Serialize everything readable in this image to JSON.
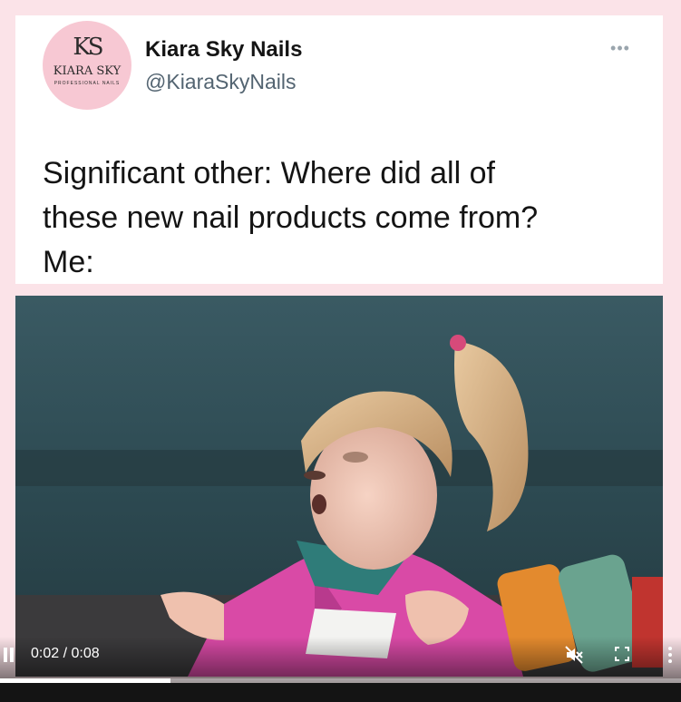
{
  "tweet": {
    "avatar": {
      "monogram": "KS",
      "brand": "KIARA SKY",
      "sub": "PROFESSIONAL NAILS"
    },
    "display_name": "Kiara Sky Nails",
    "handle": "@KiaraSkyNails",
    "more_label": "•••",
    "text": "Significant other: Where did all of\nthese new nail products come from?\nMe:"
  },
  "video": {
    "time_label": "0:02 / 0:08",
    "progress": 0.25,
    "icons": {
      "play_pause": "pause-icon",
      "mute": "muted-speaker-icon",
      "fullscreen": "fullscreen-icon",
      "menu": "more-vertical-icon"
    }
  },
  "colors": {
    "page_bg": "#fbe3e8",
    "card_bg": "#ffffff",
    "handle": "#536471",
    "avatar_bg": "#f7c8d3"
  }
}
